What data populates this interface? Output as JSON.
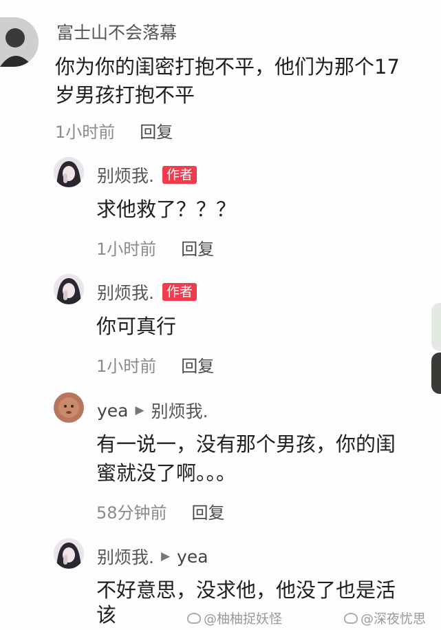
{
  "comments": [
    {
      "username": "富士山不会落幕",
      "lines": [
        "你为你的闺密打抱不平，他们为那个17",
        "岁男孩打抱不平"
      ],
      "time": "1小时前",
      "reply": "回复"
    },
    {
      "username": "别烦我.",
      "badge": "作者",
      "lines": [
        "求他救了？？？"
      ],
      "time": "1小时前",
      "reply": "回复"
    },
    {
      "username": "别烦我.",
      "badge": "作者",
      "lines": [
        "你可真行"
      ],
      "time": "1小时前",
      "reply": "回复"
    },
    {
      "username": "yea",
      "reply_to": "别烦我.",
      "lines": [
        "有一说一，没有那个男孩，你的闺",
        "蜜就没了啊。。。"
      ],
      "time": "58分钟前",
      "reply": "回复"
    },
    {
      "username": "别烦我.",
      "reply_to": "yea",
      "lines": [
        "不好意思，没求他，他没了也是活",
        "该"
      ]
    }
  ],
  "watermarks": [
    "@柚柚捉妖怪",
    "@深夜忧思"
  ],
  "colors": {
    "badge": "#ef3d4e",
    "meta": "#8a8a8a"
  }
}
